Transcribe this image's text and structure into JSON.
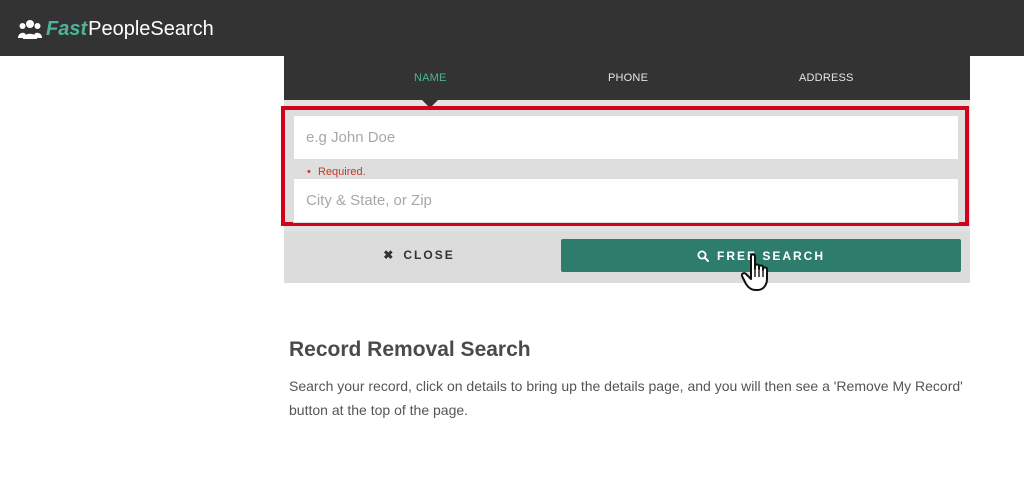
{
  "header": {
    "logo_fast": "Fast",
    "logo_rest": "PeopleSearch",
    "logo_icon": "people-icon",
    "brand_color": "#4fb59a",
    "background": "#333333"
  },
  "tabs": [
    {
      "label": "NAME",
      "active": true
    },
    {
      "label": "PHONE",
      "active": false
    },
    {
      "label": "ADDRESS",
      "active": false
    }
  ],
  "form": {
    "name_placeholder": "e.g John Doe",
    "name_value": "",
    "location_placeholder": "City & State, or Zip",
    "location_value": "",
    "required_message": "Required.",
    "highlight_color": "#d0021b"
  },
  "actions": {
    "close_label": "CLOSE",
    "close_icon": "x-icon",
    "search_label": "FREE SEARCH",
    "search_icon": "search-icon",
    "search_color": "#2e7d6c"
  },
  "content": {
    "title": "Record Removal Search",
    "body": "Search your record, click on details to bring up the details page, and you will then see a 'Remove My Record' button at the top of the page."
  }
}
